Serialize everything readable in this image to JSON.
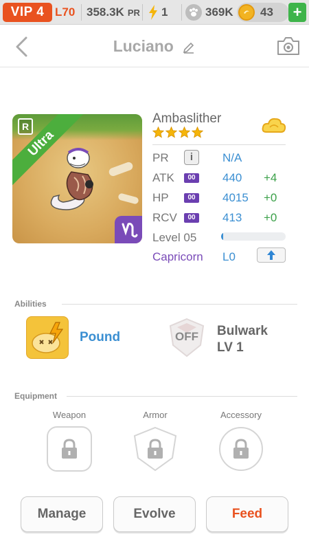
{
  "status_bar": {
    "vip": "VIP 4",
    "level": "L70",
    "power": "358.3K",
    "power_unit": "PR",
    "energy": "1",
    "paws": "369K",
    "coins": "43",
    "plus": "+"
  },
  "header": {
    "title": "Luciano"
  },
  "monster": {
    "name": "Ambaslither",
    "rarity_tag": "R",
    "rarity_ribbon": "Ultra",
    "star_count": 4,
    "stats": [
      {
        "label": "PR",
        "value": "N/A",
        "bonus": ""
      },
      {
        "label": "ATK",
        "badge": "00",
        "value": "440",
        "bonus": "+4"
      },
      {
        "label": "HP",
        "badge": "00",
        "value": "4015",
        "bonus": "+0"
      },
      {
        "label": "RCV",
        "badge": "00",
        "value": "413",
        "bonus": "+0"
      }
    ],
    "info_icon": "i",
    "level": "Level 05",
    "level_progress": 0.03,
    "zodiac": "Capricorn",
    "zodiac_level": "L0"
  },
  "abilities": {
    "title": "Abilities",
    "ability1": "Pound",
    "ability2_name": "Bulwark",
    "ability2_level": "LV 1",
    "off_label": "OFF"
  },
  "equipment": {
    "title": "Equipment",
    "slots": [
      "Weapon",
      "Armor",
      "Accessory"
    ]
  },
  "actions": {
    "manage": "Manage",
    "evolve": "Evolve",
    "feed": "Feed"
  },
  "colors": {
    "accent_orange": "#e9521f",
    "stat_blue": "#3b8fd2",
    "bonus_green": "#3ca14a",
    "zodiac_purple": "#7a4bb8"
  }
}
